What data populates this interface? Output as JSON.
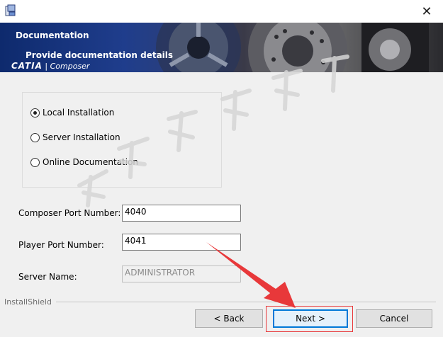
{
  "window": {
    "close_glyph": "✕"
  },
  "banner": {
    "header": "Documentation",
    "subheader": "Provide documentation details",
    "brand_main": "CATIA",
    "brand_sep": " | ",
    "brand_product": "Composer"
  },
  "options": {
    "local": "Local Installation",
    "server": "Server Installation",
    "online": "Online Documentation",
    "selected": "local"
  },
  "fields": {
    "composer_port_label": "Composer Port Number:",
    "composer_port_value": "4040",
    "player_port_label": "Player Port Number:",
    "player_port_value": "4041",
    "server_name_label": "Server Name:",
    "server_name_value": "ADMINISTRATOR"
  },
  "footer": {
    "brand": "InstallShield",
    "back": "< Back",
    "next": "Next >",
    "cancel": "Cancel"
  },
  "colors": {
    "banner_blue": "#1f3d8c",
    "highlight_red": "#e8383a",
    "default_button_border": "#0078d7"
  }
}
